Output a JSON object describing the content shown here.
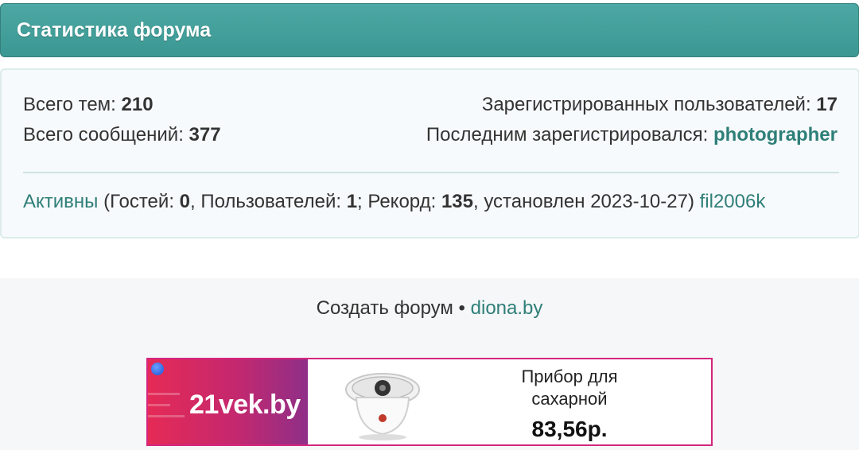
{
  "header": {
    "title": "Статистика форума"
  },
  "stats": {
    "topics_label": "Всего тем: ",
    "topics_value": "210",
    "messages_label": "Всего сообщений: ",
    "messages_value": "377",
    "registered_label": "Зарегистрированных пользователей: ",
    "registered_value": "17",
    "last_registered_label": "Последним зарегистрировался: ",
    "last_registered_user": "photographer"
  },
  "active": {
    "link": "Активны",
    "guests_prefix": " (Гостей: ",
    "guests_value": "0",
    "users_prefix": ", Пользователей: ",
    "users_value": "1",
    "record_prefix": "; Рекорд: ",
    "record_value": "135",
    "record_suffix": ", установлен 2023-10-27) ",
    "user_link": "fil2006k"
  },
  "footer": {
    "create_text": "Создать форум",
    "separator": " • ",
    "site_link": "diona.by"
  },
  "ad": {
    "brand": "21vek.by",
    "product_line1": "Прибор для",
    "product_line2": "сахарной",
    "price": "83,56р.",
    "accent_color": "#d4267f"
  }
}
